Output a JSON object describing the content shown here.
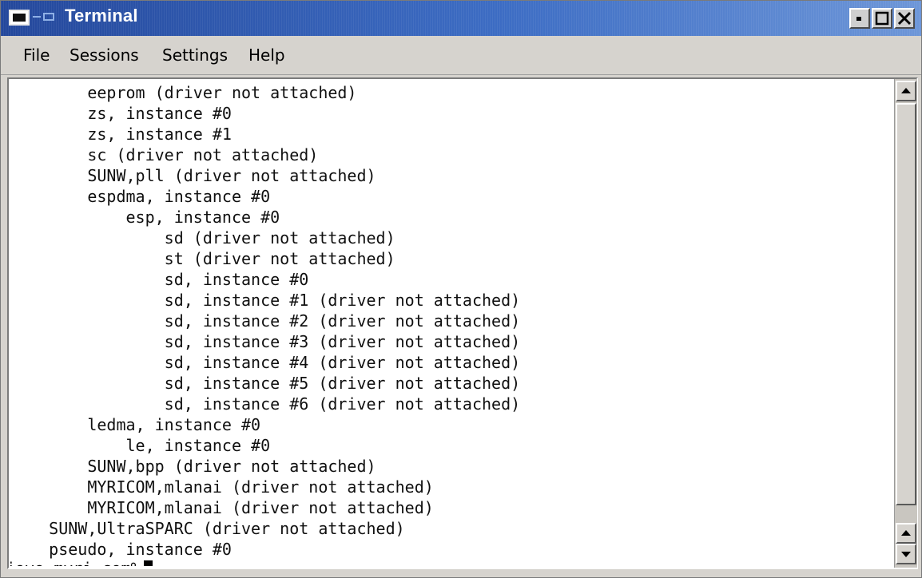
{
  "window": {
    "title": "Terminal"
  },
  "menu": {
    "items": [
      "File",
      "Sessions",
      "Settings",
      "Help"
    ]
  },
  "terminal": {
    "lines": [
      "        eeprom (driver not attached)",
      "        zs, instance #0",
      "        zs, instance #1",
      "        sc (driver not attached)",
      "        SUNW,pll (driver not attached)",
      "        espdma, instance #0",
      "            esp, instance #0",
      "                sd (driver not attached)",
      "                st (driver not attached)",
      "                sd, instance #0",
      "                sd, instance #1 (driver not attached)",
      "                sd, instance #2 (driver not attached)",
      "                sd, instance #3 (driver not attached)",
      "                sd, instance #4 (driver not attached)",
      "                sd, instance #5 (driver not attached)",
      "                sd, instance #6 (driver not attached)",
      "        ledma, instance #0",
      "            le, instance #0",
      "        SUNW,bpp (driver not attached)",
      "        MYRICOM,mlanai (driver not attached)",
      "        MYRICOM,mlanai (driver not attached)",
      "    SUNW,UltraSPARC (driver not attached)",
      "    pseudo, instance #0"
    ],
    "prompt": "jove.myri.com%"
  },
  "icons": {
    "window_menu": "window-menu-icon",
    "minimize": "minimize-icon",
    "maximize": "maximize-icon",
    "close": "close-icon",
    "scroll_up": "arrow-up-icon",
    "scroll_down": "arrow-down-icon"
  },
  "colors": {
    "titlebar": "#24489c",
    "titlebar_light": "#6d96d8",
    "terminal_bg": "#ffffff",
    "terminal_fg": "#101010",
    "chrome": "#d6d3ce"
  }
}
